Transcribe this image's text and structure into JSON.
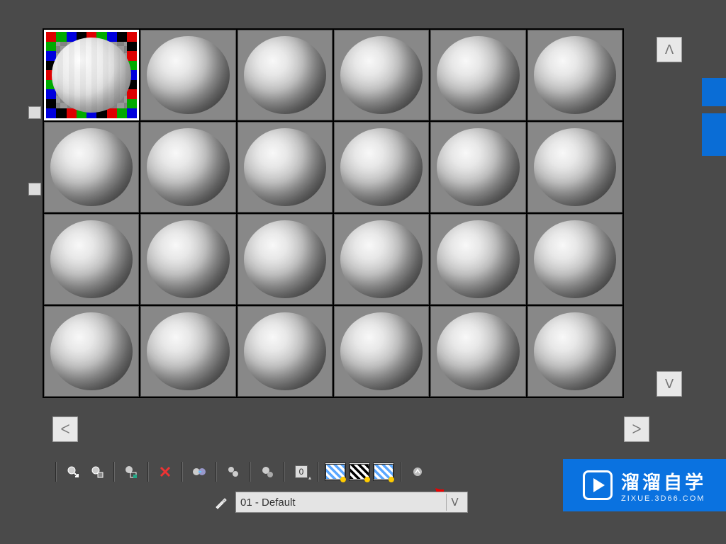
{
  "grid": {
    "rows": 4,
    "cols": 6,
    "selected_index": 0
  },
  "scroll": {
    "up": "ᐱ",
    "down": "ᐯ",
    "left": "ᐸ",
    "right": "ᐳ"
  },
  "toolbar": {
    "get_material": "Get Material",
    "put_to_scene": "Put to Scene",
    "assign": "Assign to Selection",
    "delete": "×",
    "reset": "Reset",
    "make_unique": "Make Unique",
    "put_to_library": "Put to Library",
    "material_id": "0",
    "show_map_a": "Show Shaded in Viewport",
    "show_map_b": "Show Realistic in Viewport",
    "show_map_c": "Show End Result",
    "go_parent": "Go to Parent"
  },
  "material": {
    "picker": "Pick Material from Object",
    "selected": "01 - Default",
    "chev": "ᐯ"
  },
  "watermark": {
    "cn": "溜溜自学",
    "url": "ZIXUE.3D66.COM"
  }
}
